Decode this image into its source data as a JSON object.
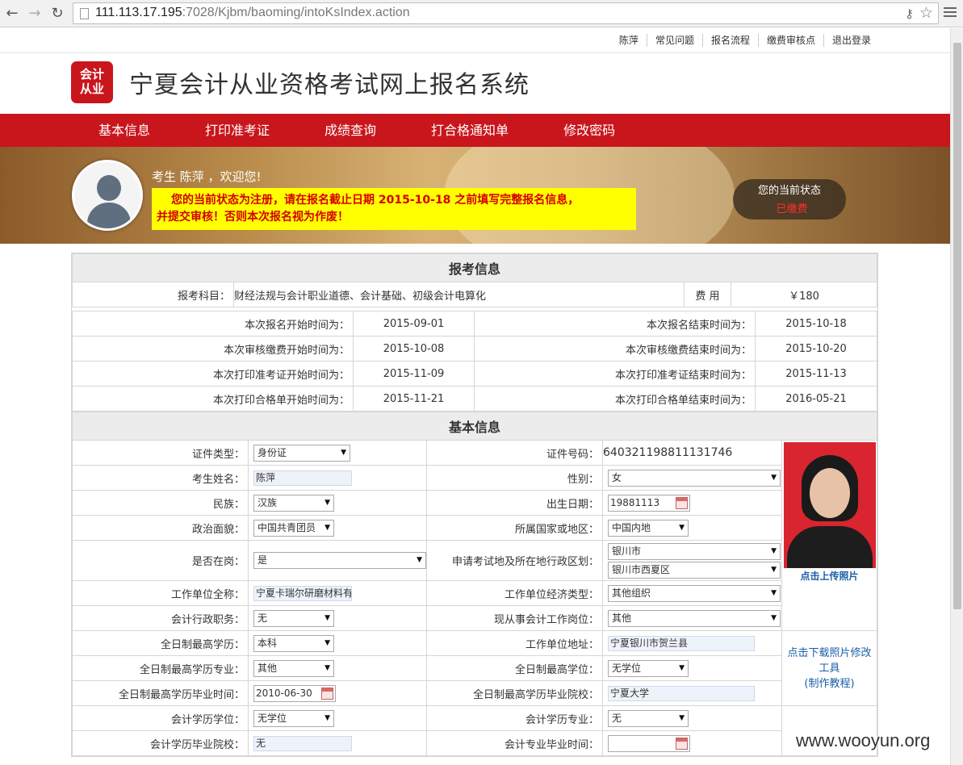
{
  "browser": {
    "url_host": "111.113.17.195",
    "url_path": ":7028/Kjbm/baoming/intoKsIndex.action"
  },
  "toplinks": [
    "陈萍",
    "常见问题",
    "报名流程",
    "缴费审核点",
    "退出登录"
  ],
  "header": {
    "logo_line1": "会计",
    "logo_line2": "从业",
    "title": "宁夏会计从业资格考试网上报名系统"
  },
  "nav": [
    "基本信息",
    "打印准考证",
    "成绩查询",
    "打合格通知单",
    "修改密码"
  ],
  "banner": {
    "welcome": "考生 陈萍 ，欢迎您!",
    "notice_line1": "您的当前状态为注册，请在报名截止日期 2015-10-18 之前填写完整报名信息，",
    "notice_line2": "并提交审核！否则本次报名视为作废！",
    "status_label": "您的当前状态",
    "status_value": "已缴费"
  },
  "exam": {
    "section_title": "报考信息",
    "subject_label": "报考科目：",
    "subject_value": "财经法规与会计职业道德、会计基础、初级会计电算化",
    "fee_label": "费 用",
    "fee_value": "￥180",
    "schedule": [
      {
        "l1": "本次报名开始时间为：",
        "v1": "2015-09-01",
        "l2": "本次报名结束时间为：",
        "v2": "2015-10-18"
      },
      {
        "l1": "本次审核缴费开始时间为：",
        "v1": "2015-10-08",
        "l2": "本次审核缴费结束时间为：",
        "v2": "2015-10-20"
      },
      {
        "l1": "本次打印准考证开始时间为：",
        "v1": "2015-11-09",
        "l2": "本次打印准考证结束时间为：",
        "v2": "2015-11-13"
      },
      {
        "l1": "本次打印合格单开始时间为：",
        "v1": "2015-11-21",
        "l2": "本次打印合格单结束时间为：",
        "v2": "2016-05-21"
      }
    ]
  },
  "basic": {
    "section_title": "基本信息",
    "id_type_label": "证件类型：",
    "id_type": "身份证",
    "id_no_label": "证件号码：",
    "id_no": "640321198811131746",
    "name_label": "考生姓名：",
    "name": "陈萍",
    "gender_label": "性别：",
    "gender": "女",
    "ethnic_label": "民族：",
    "ethnic": "汉族",
    "birth_label": "出生日期：",
    "birth": "19881113",
    "political_label": "政治面貌：",
    "political": "中国共青团员",
    "region_label": "所属国家或地区：",
    "region": "中国内地",
    "onduty_label": "是否在岗：",
    "onduty": "是",
    "exam_area_label": "申请考试地及所在地行政区划：",
    "exam_area_city": "银川市",
    "exam_area_district": "银川市西夏区",
    "employer_label": "工作单位全称：",
    "employer": "宁夏卡瑞尔研磨材料有",
    "employer_type_label": "工作单位经济类型：",
    "employer_type": "其他组织",
    "admin_post_label": "会计行政职务：",
    "admin_post": "无",
    "current_post_label": "现从事会计工作岗位：",
    "current_post": "其他",
    "edu_label": "全日制最高学历：",
    "edu": "本科",
    "address_label": "工作单位地址：",
    "address": "宁夏银川市贺兰县",
    "major_label": "全日制最高学历专业：",
    "major": "其他",
    "degree_label": "全日制最高学位：",
    "degree": "无学位",
    "grad_time_label": "全日制最高学历毕业时间：",
    "grad_time": "2010-06-30",
    "school_label": "全日制最高学历毕业院校：",
    "school": "宁夏大学",
    "acc_degree_label": "会计学历学位：",
    "acc_degree": "无学位",
    "acc_major_label": "会计学历专业：",
    "acc_major": "无",
    "acc_school_label": "会计学历毕业院校：",
    "acc_school": "无",
    "acc_grad_label": "会计专业毕业时间：",
    "acc_grad": "",
    "upload_photo": "点击上传照片",
    "download_tool_line1": "点击下载照片修改",
    "download_tool_line2": "工具",
    "download_tool_line3": "(制作教程)"
  },
  "watermark": "www.wooyun.org"
}
